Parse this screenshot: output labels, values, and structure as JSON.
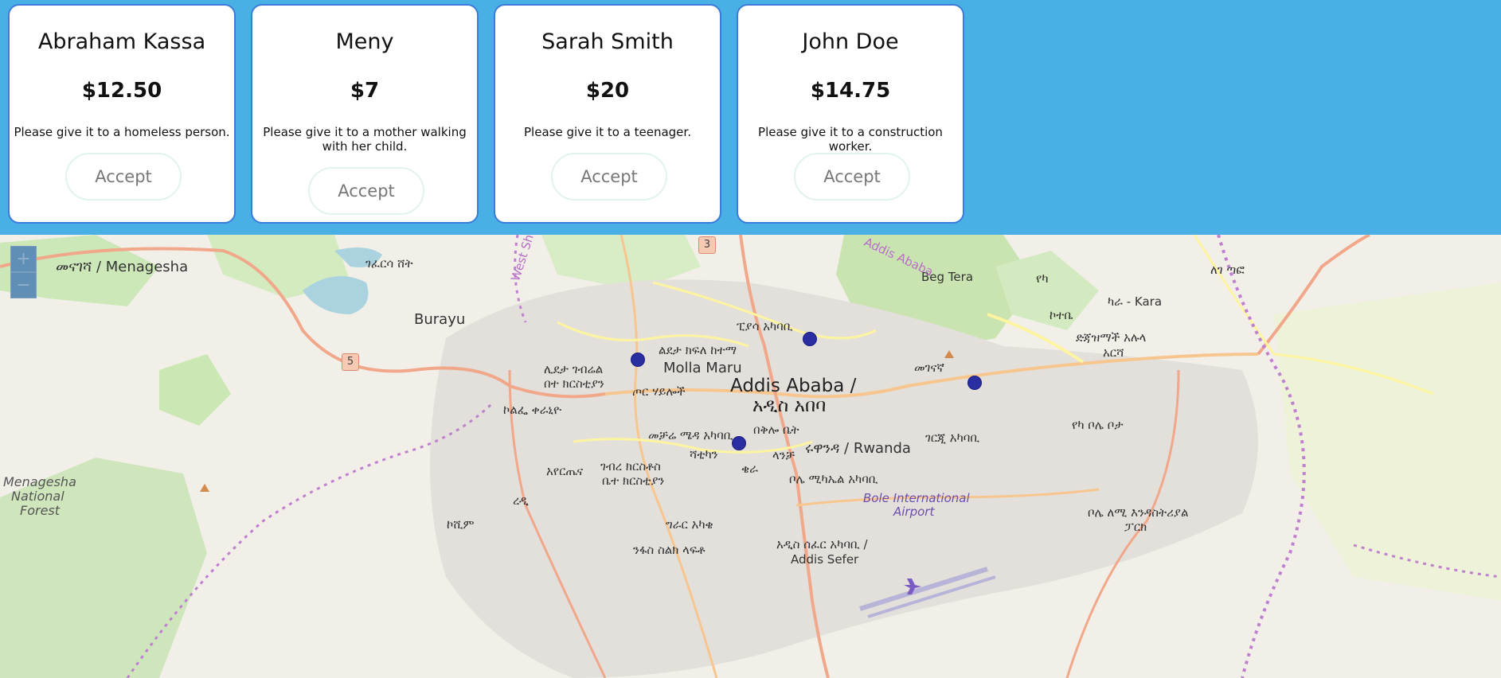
{
  "requests": [
    {
      "name": "Abraham Kassa",
      "amount": "$12.50",
      "message": "Please give it to a homeless person.",
      "button": "Accept"
    },
    {
      "name": "Meny",
      "amount": "$7",
      "message": "Please give it to a mother walking with her child.",
      "button": "Accept"
    },
    {
      "name": "Sarah Smith",
      "amount": "$20",
      "message": "Please give it to a teenager.",
      "button": "Accept"
    },
    {
      "name": "John Doe",
      "amount": "$14.75",
      "message": "Please give it to a construction worker.",
      "button": "Accept"
    }
  ],
  "map": {
    "zoom_in": "+",
    "zoom_out": "−",
    "labels": {
      "addis_en": "Addis Ababa /",
      "addis_am": "አዲስ አበባ",
      "menagesha": "መናገሻ / Menagesha",
      "burayu": "Burayu",
      "gefersa": "ገፈርሳ ሸት",
      "beg_tera": "Beg Tera",
      "yeka": "የካ",
      "kara": "ካራ - Kara",
      "kotebe": "ኮተቤ",
      "dejazmach_1": "ድጃዝማች አሉላ",
      "dejazmach_2": "አርሻ",
      "legetafo": "ለገ ጣፎ",
      "piassa": "ፒያሳ አካባቢ",
      "ledeta": "ልደታ ክፍለ ከተማ",
      "molla_maru": "Molla Maru",
      "lideta_church_1": "ሊደታ ገብሬል",
      "lideta_church_2": "በተ ክርስቲያን",
      "tor_hailoch": "ጦር ሃይሎች",
      "megenagna": "መገናኛ",
      "kolfe": "ኮልፌ ቀራኒዮ",
      "mechare": "መቻሬ ሜዳ አካባቢ",
      "bekelobet": "በቅሎ ቤት",
      "sitikinn": "ሻቲካን",
      "rwanda": "ሩዋንዳ / Rwanda",
      "gerji": "ገርጂ አካባቢ",
      "yeka_bole": "የካ ቦሌ ቦታ",
      "ayerteina": "አየርጤና",
      "gebre_1": "ገብረ ክርስቶስ",
      "gebre_2": "ቤተ ክርስቲያን",
      "bole_michael": "ቦሌ ሚካኤል አካባቢ",
      "bole_airport_1": "Bole International",
      "bole_airport_2": "Airport",
      "menagesha_forest_1": "Menagesha",
      "menagesha_forest_2": "National",
      "menagesha_forest_3": "Forest",
      "koshim": "ኮሺም",
      "girar": "ግራር አካቄ",
      "nefas": "ንፋስ ስልክ ላፍቶ",
      "addis_sefer_1": "አዲስ ሰፈር አካባቢ /",
      "addis_sefer_2": "Addis Sefer",
      "bole_lemi_1": "ቦሌ ለሚ እንዳስትሪያል",
      "bole_lemi_2": "ፓርክ",
      "west_shewa": "West Shewa",
      "addis_ababa_region": "Addis Ababa",
      "reda": "ረዲ",
      "kera": "ቄራ",
      "lancha": "ላንቻ"
    },
    "shields": {
      "r3": "3",
      "r5": "5"
    }
  }
}
